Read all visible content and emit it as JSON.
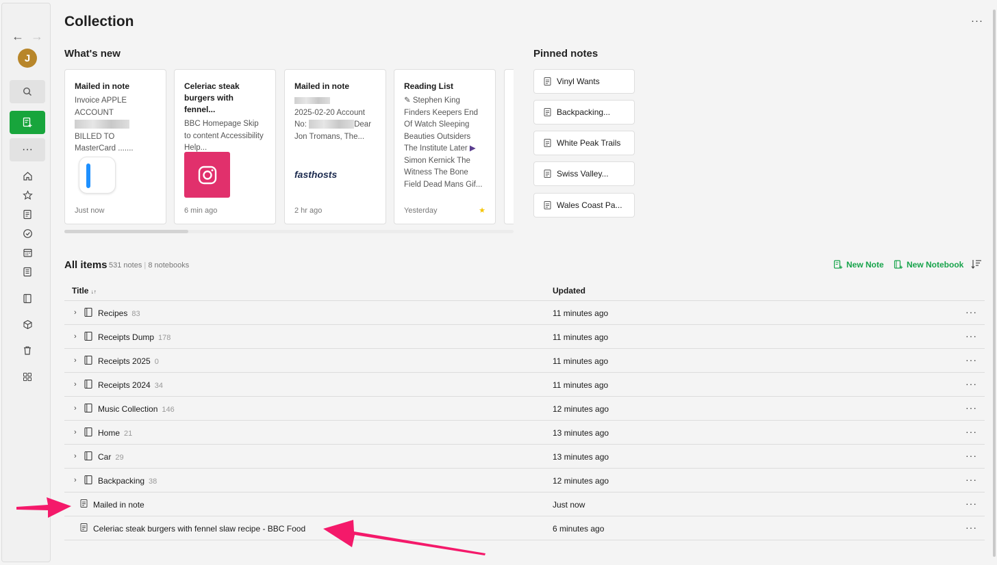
{
  "header": {
    "title": "Collection",
    "more": "···"
  },
  "sidebar": {
    "back": "←",
    "forward": "→",
    "avatar_letter": "J",
    "more": "···"
  },
  "whats_new": {
    "title": "What's new",
    "cards": [
      {
        "title": "Mailed in note",
        "body_a": "Invoice APPLE ACCOUNT",
        "body_b": "BILLED TO MasterCard .......",
        "time": "Just now"
      },
      {
        "title": "Celeriac steak burgers with fennel...",
        "body": "BBC Homepage Skip to content Accessibility Help...",
        "time": "6 min ago"
      },
      {
        "title": "Mailed in note",
        "body_a": "2025-02-20 Account No:",
        "body_b": "Dear Jon Tromans, The...",
        "logo": "fasthosts",
        "time": "2 hr ago"
      },
      {
        "title": "Reading List",
        "body": "Stephen King Finders Keepers End Of Watch Sleeping Beauties Outsiders The Institute Later",
        "body_b": "Simon Kernick The Witness The Bone Field Dead Mans Gif...",
        "time": "Yesterday"
      }
    ]
  },
  "pinned": {
    "title": "Pinned notes",
    "items": [
      "Vinyl Wants",
      "Backpacking...",
      "White Peak Trails",
      "Swiss Valley...",
      "Wales Coast Pa..."
    ]
  },
  "all_items": {
    "title": "All items",
    "notes_count": "531 notes",
    "separator": "|",
    "notebooks_count": "8 notebooks",
    "new_note": "New Note",
    "new_notebook": "New Notebook",
    "col_title": "Title",
    "col_sort": "↓↑",
    "col_updated": "Updated",
    "rows": [
      {
        "name": "Recipes",
        "count": "83",
        "updated": "11 minutes ago"
      },
      {
        "name": "Receipts Dump",
        "count": "178",
        "updated": "11 minutes ago"
      },
      {
        "name": "Receipts 2025",
        "count": "0",
        "updated": "11 minutes ago"
      },
      {
        "name": "Receipts 2024",
        "count": "34",
        "updated": "11 minutes ago"
      },
      {
        "name": "Music Collection",
        "count": "146",
        "updated": "12 minutes ago"
      },
      {
        "name": "Home",
        "count": "21",
        "updated": "13 minutes ago"
      },
      {
        "name": "Car",
        "count": "29",
        "updated": "13 minutes ago"
      },
      {
        "name": "Backpacking",
        "count": "38",
        "updated": "12 minutes ago"
      },
      {
        "name": "Mailed in note",
        "updated": "Just now"
      },
      {
        "name": "Celeriac steak burgers with fennel slaw recipe - BBC Food",
        "updated": "6 minutes ago"
      }
    ],
    "row_more": "···"
  },
  "colors": {
    "accent": "#18a53c",
    "annotation": "#f4196a",
    "avatar": "#b8862a",
    "instagram": "#e1306c"
  }
}
